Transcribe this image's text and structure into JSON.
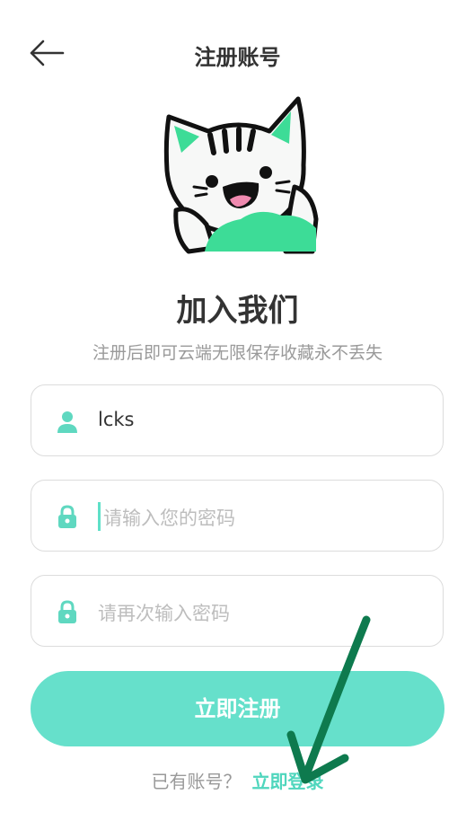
{
  "header": {
    "back_icon": "arrow-left-icon",
    "title": "注册账号"
  },
  "mascot": {
    "icon": "cat-mascot",
    "accent_color": "#3ddc97"
  },
  "intro": {
    "heading": "加入我们",
    "subheading": "注册后即可云端无限保存收藏永不丢失"
  },
  "form": {
    "username": {
      "icon": "user-icon",
      "value": "lcks"
    },
    "password": {
      "icon": "lock-icon",
      "placeholder": "请输入您的密码",
      "value": ""
    },
    "confirm_password": {
      "icon": "lock-icon",
      "placeholder": "请再次输入密码",
      "value": ""
    },
    "submit_label": "立即注册"
  },
  "footer": {
    "question": "已有账号？",
    "login_link": "立即登录"
  },
  "colors": {
    "primary": "#66e0cb",
    "link": "#4fd6bd",
    "icon": "#5fd8c0",
    "annotation_arrow": "#0e7a4e"
  }
}
